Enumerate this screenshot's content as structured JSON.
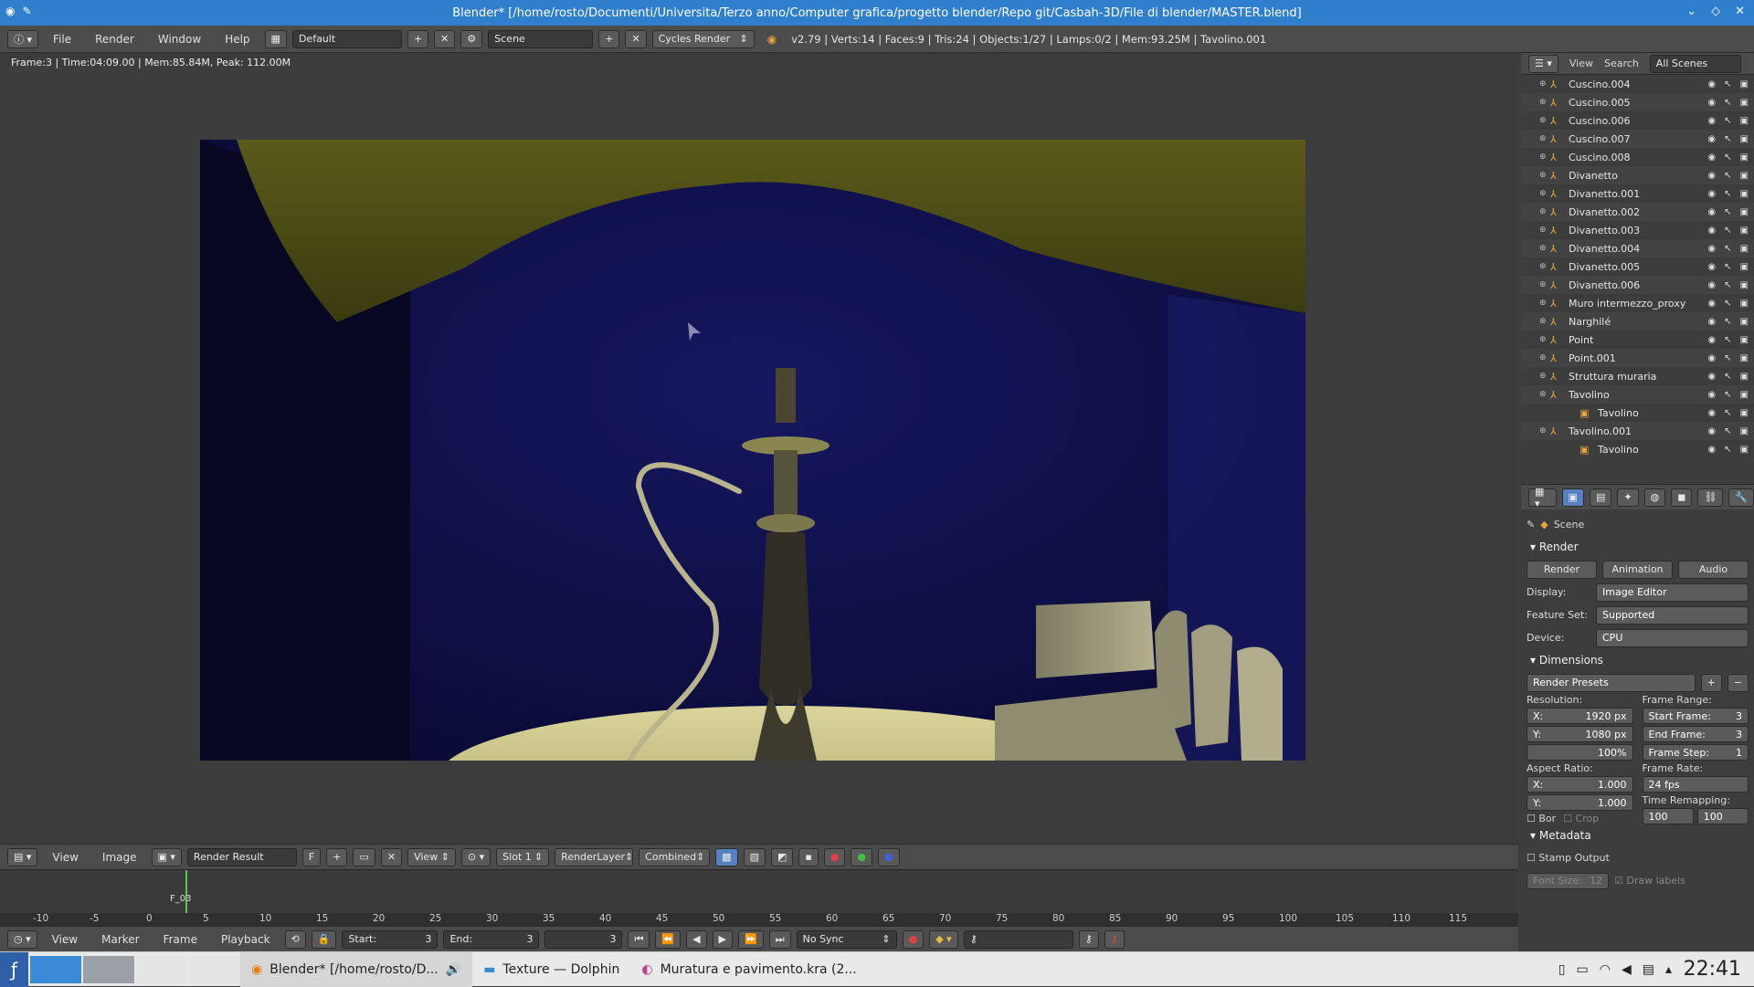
{
  "window": {
    "title": "Blender* [/home/rosto/Documenti/Universita/Terzo anno/Computer grafica/progetto blender/Repo git/Casbah-3D/File di blender/MASTER.blend]"
  },
  "info_header": {
    "menus": [
      "File",
      "Render",
      "Window",
      "Help"
    ],
    "layout": "Default",
    "scene": "Scene",
    "engine": "Cycles Render",
    "stats": "v2.79 | Verts:14 | Faces:9 | Tris:24 | Objects:1/27 | Lamps:0/2 | Mem:93.25M | Tavolino.001"
  },
  "editor": {
    "status": "Frame:3 | Time:04:09.00 | Mem:85.84M, Peak: 112.00M"
  },
  "image_header": {
    "menus": [
      "View",
      "Image"
    ],
    "image_name": "Render Result",
    "f_label": "F",
    "view": "View",
    "slot": "Slot 1",
    "layer": "RenderLayer",
    "pass": "Combined"
  },
  "timeline": {
    "ticks": [
      "-10",
      "-5",
      "0",
      "5",
      "10",
      "15",
      "20",
      "25",
      "30",
      "35",
      "40",
      "45",
      "50",
      "55",
      "60",
      "65",
      "70",
      "75",
      "80",
      "85",
      "90",
      "95",
      "100",
      "105",
      "110",
      "115"
    ],
    "marker": "F_03",
    "menus": [
      "View",
      "Marker",
      "Frame",
      "Playback"
    ],
    "start": "Start:",
    "start_val": "3",
    "end": "End:",
    "end_val": "3",
    "current": "3",
    "sync": "No Sync"
  },
  "outliner": {
    "menus": [
      "View",
      "Search"
    ],
    "filter": "All Scenes",
    "items": [
      {
        "name": "Cuscino.004"
      },
      {
        "name": "Cuscino.005"
      },
      {
        "name": "Cuscino.006"
      },
      {
        "name": "Cuscino.007"
      },
      {
        "name": "Cuscino.008"
      },
      {
        "name": "Divanetto"
      },
      {
        "name": "Divanetto.001"
      },
      {
        "name": "Divanetto.002"
      },
      {
        "name": "Divanetto.003"
      },
      {
        "name": "Divanetto.004"
      },
      {
        "name": "Divanetto.005"
      },
      {
        "name": "Divanetto.006"
      },
      {
        "name": "Muro intermezzo_proxy"
      },
      {
        "name": "Narghilé"
      },
      {
        "name": "Point"
      },
      {
        "name": "Point.001"
      },
      {
        "name": "Struttura muraria"
      },
      {
        "name": "Tavolino"
      },
      {
        "name": "Tavolino"
      },
      {
        "name": "Tavolino.001"
      },
      {
        "name": "Tavolino"
      }
    ]
  },
  "properties": {
    "scene": "Scene",
    "render_section": "Render",
    "tabs": [
      "Render",
      "Animation",
      "Audio"
    ],
    "display_label": "Display:",
    "display_value": "Image Editor",
    "feature_label": "Feature Set:",
    "feature_value": "Supported",
    "device_label": "Device:",
    "device_value": "CPU",
    "dimensions_section": "Dimensions",
    "presets": "Render Presets",
    "resolution_label": "Resolution:",
    "res_x": "1920 px",
    "res_y": "1080 px",
    "res_pct": "100%",
    "frame_range_label": "Frame Range:",
    "start_frame": "Start Frame:",
    "start_frame_val": "3",
    "end_frame": "End Frame:",
    "end_frame_val": "3",
    "frame_step": "Frame Step:",
    "frame_step_val": "1",
    "aspect_label": "Aspect Ratio:",
    "aspect_x": "1.000",
    "aspect_y": "1.000",
    "frame_rate_label": "Frame Rate:",
    "frame_rate": "24 fps",
    "time_remap_label": "Time Remapping:",
    "remap_old": "100",
    "remap_new": "100",
    "bor": "Bor",
    "crop": "Crop",
    "metadata_section": "Metadata",
    "stamp_output": "Stamp Output",
    "font_size": "Font Size:",
    "font_size_val": "12",
    "draw_labels": "Draw labels"
  },
  "taskbar": {
    "tasks": [
      {
        "label": "Blender* [/home/rosto/D..."
      },
      {
        "label": "Texture — Dolphin"
      },
      {
        "label": "Muratura e pavimento.kra (2..."
      }
    ],
    "clock": "22:41"
  },
  "colors": {
    "titlebar": "#2f7fcc",
    "panel": "#3d3d3d",
    "header": "#4b4b4b",
    "accent_orange": "#e8a53d",
    "frame_cursor": "#59c84e"
  }
}
